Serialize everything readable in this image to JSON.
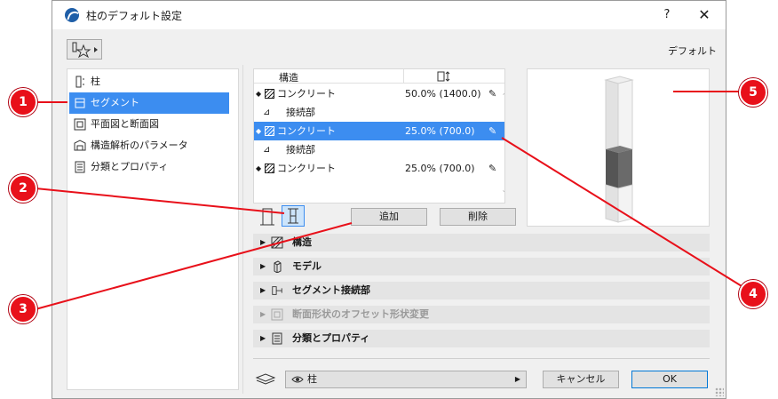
{
  "dialog": {
    "title": "柱のデフォルト設定",
    "help_label": "?",
    "close_label": "✕",
    "favorite_icon": "favorite-star-icon",
    "default_label": "デフォルト"
  },
  "nav": {
    "items": [
      {
        "label": "柱",
        "icon": "column-icon",
        "selected": false
      },
      {
        "label": "セグメント",
        "icon": "segment-icon",
        "selected": true
      },
      {
        "label": "平面図と断面図",
        "icon": "floorplan-section-icon",
        "selected": false
      },
      {
        "label": "構造解析のパラメータ",
        "icon": "structural-analysis-icon",
        "selected": false
      },
      {
        "label": "分類とプロパティ",
        "icon": "classification-icon",
        "selected": false
      }
    ]
  },
  "segments": {
    "header_structure": "構造",
    "header_height_icon": "height-icon",
    "rows": [
      {
        "type": "segment",
        "material": "コンクリート",
        "value": "50.0% (1400.0)",
        "selected": false
      },
      {
        "type": "joint",
        "label": "接続部"
      },
      {
        "type": "segment",
        "material": "コンクリート",
        "value": "25.0% (700.0)",
        "selected": true
      },
      {
        "type": "joint",
        "label": "接続部"
      },
      {
        "type": "segment",
        "material": "コンクリート",
        "value": "25.0% (700.0)",
        "selected": false
      }
    ],
    "add_label": "追加",
    "delete_label": "削除"
  },
  "sections": [
    {
      "label": "構造",
      "icon": "structure-hatch-icon",
      "disabled": false
    },
    {
      "label": "モデル",
      "icon": "model-icon",
      "disabled": false
    },
    {
      "label": "セグメント接続部",
      "icon": "segment-joint-icon",
      "disabled": false
    },
    {
      "label": "断面形状のオフセット形状変更",
      "icon": "profile-offset-icon",
      "disabled": true
    },
    {
      "label": "分類とプロパティ",
      "icon": "classification-icon",
      "disabled": false
    }
  ],
  "footer": {
    "layer_value": "柱",
    "cancel_label": "キャンセル",
    "ok_label": "OK"
  },
  "callouts": [
    "1",
    "2",
    "3",
    "4",
    "5"
  ],
  "colors": {
    "accent": "#3c8df0",
    "callout": "#e8101a",
    "segment_highlight": "#5a5a5a"
  }
}
